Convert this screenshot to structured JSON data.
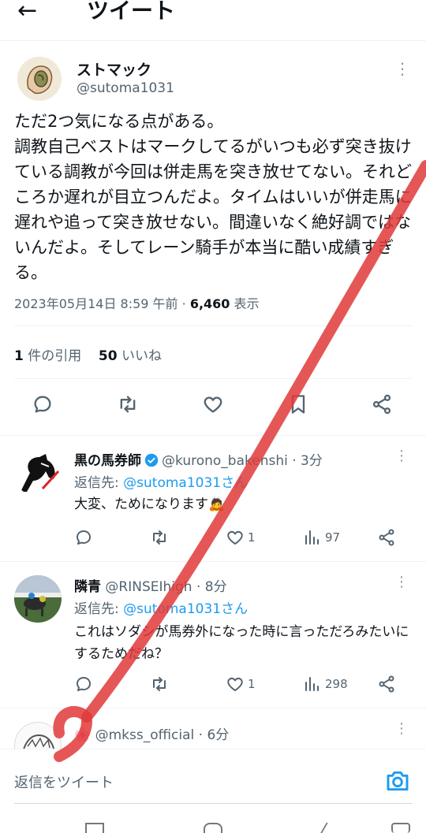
{
  "header": {
    "back_icon": "arrow-left-icon",
    "title": "ツイート"
  },
  "main_tweet": {
    "author_name": "ストマック",
    "author_handle": "@sutoma1031",
    "text": "ただ2つ気になる点がある。\n調教自己ベストはマークしてるがいつも必ず突き抜けている調教が今回は併走馬を突き放せてない。それどころか遅れが目立つんだよ。タイムはいいが併走馬に遅れや追って突き放せない。間違いなく絶好調ではないんだよ。そしてレーン騎手が本当に酷い成績すぎる。",
    "timestamp": "2023年05月14日 8:59 午前",
    "views_count": "6,460",
    "views_label": "表示",
    "quotes_count": "1",
    "quotes_label": "件の引用",
    "likes_count": "50",
    "likes_label": "いいね"
  },
  "replies": [
    {
      "name": "黒の馬券師",
      "verified": true,
      "handle": "@kurono_bakenshi",
      "time": "3分",
      "reply_to_label": "返信先:",
      "reply_to": "@sutoma1031さん",
      "text": "大変、ためになります🙇",
      "likes": "1",
      "views": "97"
    },
    {
      "name": "隣青",
      "verified": false,
      "handle": "@RINSEIhigh",
      "time": "8分",
      "reply_to_label": "返信先:",
      "reply_to": "@sutoma1031さん",
      "text": "これはソダシが馬券外になった時に言っただろみたいにするためだね？",
      "likes": "1",
      "views": "298"
    },
    {
      "name": "🌸",
      "verified": false,
      "handle": "@mkss_official",
      "time": "6分"
    }
  ],
  "reply_bar": {
    "placeholder": "返信をツイート",
    "camera_icon": "camera-icon"
  },
  "colors": {
    "accent": "#1d9bf0",
    "annotation_red": "#e03a3a"
  }
}
